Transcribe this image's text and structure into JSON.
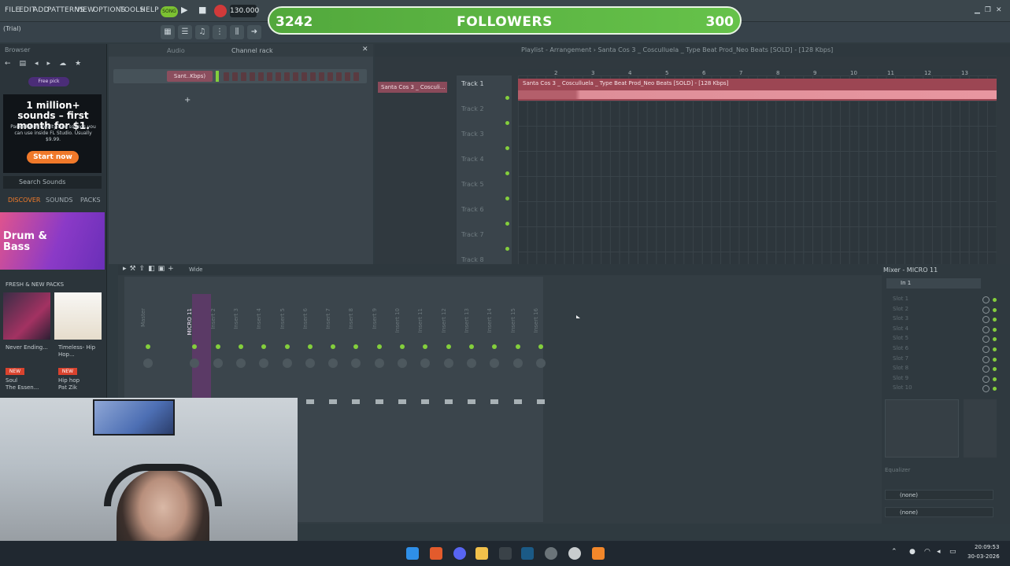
{
  "menu": {
    "items": [
      "FILE",
      "EDIT",
      "ADD",
      "PATTERNS",
      "VIEW",
      "OPTIONS",
      "TOOLS",
      "HELP"
    ]
  },
  "transport": {
    "song_label": "SONG",
    "tempo": "130.000"
  },
  "trial_label": "(Trial)",
  "overlay": {
    "left_count": "3242",
    "title": "FOLLOWERS",
    "right_count": "300"
  },
  "browser": {
    "title": "Browser",
    "free_label": "Free pick",
    "ad": {
      "title": "1 million+ sounds – first month for $1.",
      "subtitle": "Packed with royalty-free sounds you can use inside FL Studio. Usually $9.99.",
      "button": "Start now"
    },
    "search_placeholder": "Search Sounds",
    "tabs": [
      "DISCOVER",
      "SOUNDS",
      "PACKS"
    ],
    "genre": "Drum & Bass",
    "fresh_title": "FRESH & NEW PACKS",
    "packs": [
      {
        "name": "Never Ending...",
        "badge": "NEW",
        "genre": "Soul",
        "author": "The Essen..."
      },
      {
        "name": "Timeless- Hip Hop...",
        "badge": "NEW",
        "genre": "Hip hop",
        "author": "Pat Zik"
      }
    ]
  },
  "channel_rack": {
    "title": "Channel rack",
    "audio_label": "Audio",
    "channel_name": "Sant..Kbps)"
  },
  "playlist": {
    "title": "Playlist - Arrangement › Santa Cos 3 _ Cosculluela _ Type Beat Prod_Neo Beats [SOLD] - [128 Kbps]",
    "clip_button": "Santa Cos 3 _ Cosculi...",
    "tracks": [
      "Track 1",
      "Track 2",
      "Track 3",
      "Track 4",
      "Track 5",
      "Track 6",
      "Track 7",
      "Track 8"
    ],
    "ruler": [
      "2",
      "3",
      "4",
      "5",
      "6",
      "7",
      "8",
      "9",
      "10",
      "11",
      "12",
      "13"
    ],
    "clip_label": "Santa Cos 3 _ Cosculluela _ Type Beat Prod_Neo Beats [SOLD] - [128 Kbps]"
  },
  "mixer": {
    "wide_label": "Wide",
    "strips": [
      "Master",
      "MICRO 11",
      "Insert 2",
      "Insert 3",
      "Insert 4",
      "Insert 5",
      "Insert 6",
      "Insert 7",
      "Insert 8",
      "Insert 9",
      "Insert 10",
      "Insert 11",
      "Insert 12",
      "Insert 13",
      "Insert 14",
      "Insert 15",
      "Insert 16"
    ],
    "side": {
      "title": "Mixer - MICRO 11",
      "input": "In 1",
      "slots": [
        "Slot 1",
        "Slot 2",
        "Slot 3",
        "Slot 4",
        "Slot 5",
        "Slot 6",
        "Slot 7",
        "Slot 8",
        "Slot 9",
        "Slot 10"
      ],
      "eq_label": "Equalizer",
      "out1": "(none)",
      "out2": "(none)"
    }
  },
  "taskbar": {
    "time": "20:09:53",
    "date": "30-03-2026"
  },
  "colors": {
    "accent_green": "#84cf3c",
    "clip": "#9c4653",
    "followers_bar": "#5fb944",
    "ad_button": "#f0792a"
  }
}
